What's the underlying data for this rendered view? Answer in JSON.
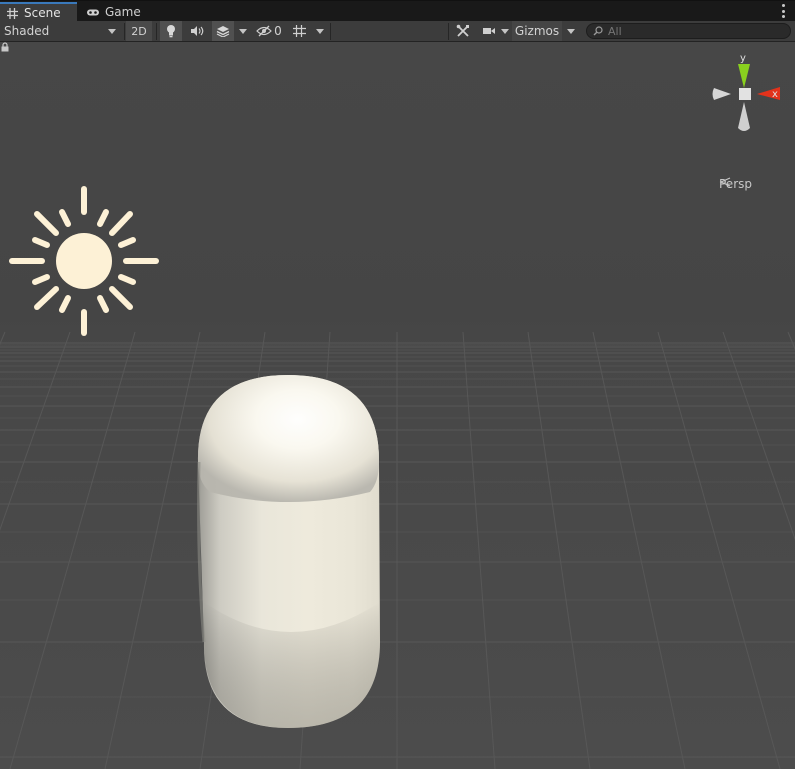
{
  "tabs": [
    {
      "label": "Scene",
      "icon": "scene-grid-icon",
      "active": true
    },
    {
      "label": "Game",
      "icon": "gamepad-icon",
      "active": false
    }
  ],
  "toolbar": {
    "draw_mode": "Shaded",
    "mode_2d": "2D",
    "hidden_count": "0",
    "gizmos": "Gizmos",
    "search_placeholder": "All"
  },
  "gizmo": {
    "axis_y": "y",
    "axis_x": "x",
    "projection": "Persp",
    "colors": {
      "y": "#89d01e",
      "x": "#e3321b",
      "neutral": "#cfcfcf"
    }
  },
  "scene": {
    "objects": [
      "directional-light",
      "capsule"
    ],
    "colors": {
      "background": "#464646",
      "light_icon": "#fdf1d6",
      "capsule": "#efebdd"
    }
  }
}
